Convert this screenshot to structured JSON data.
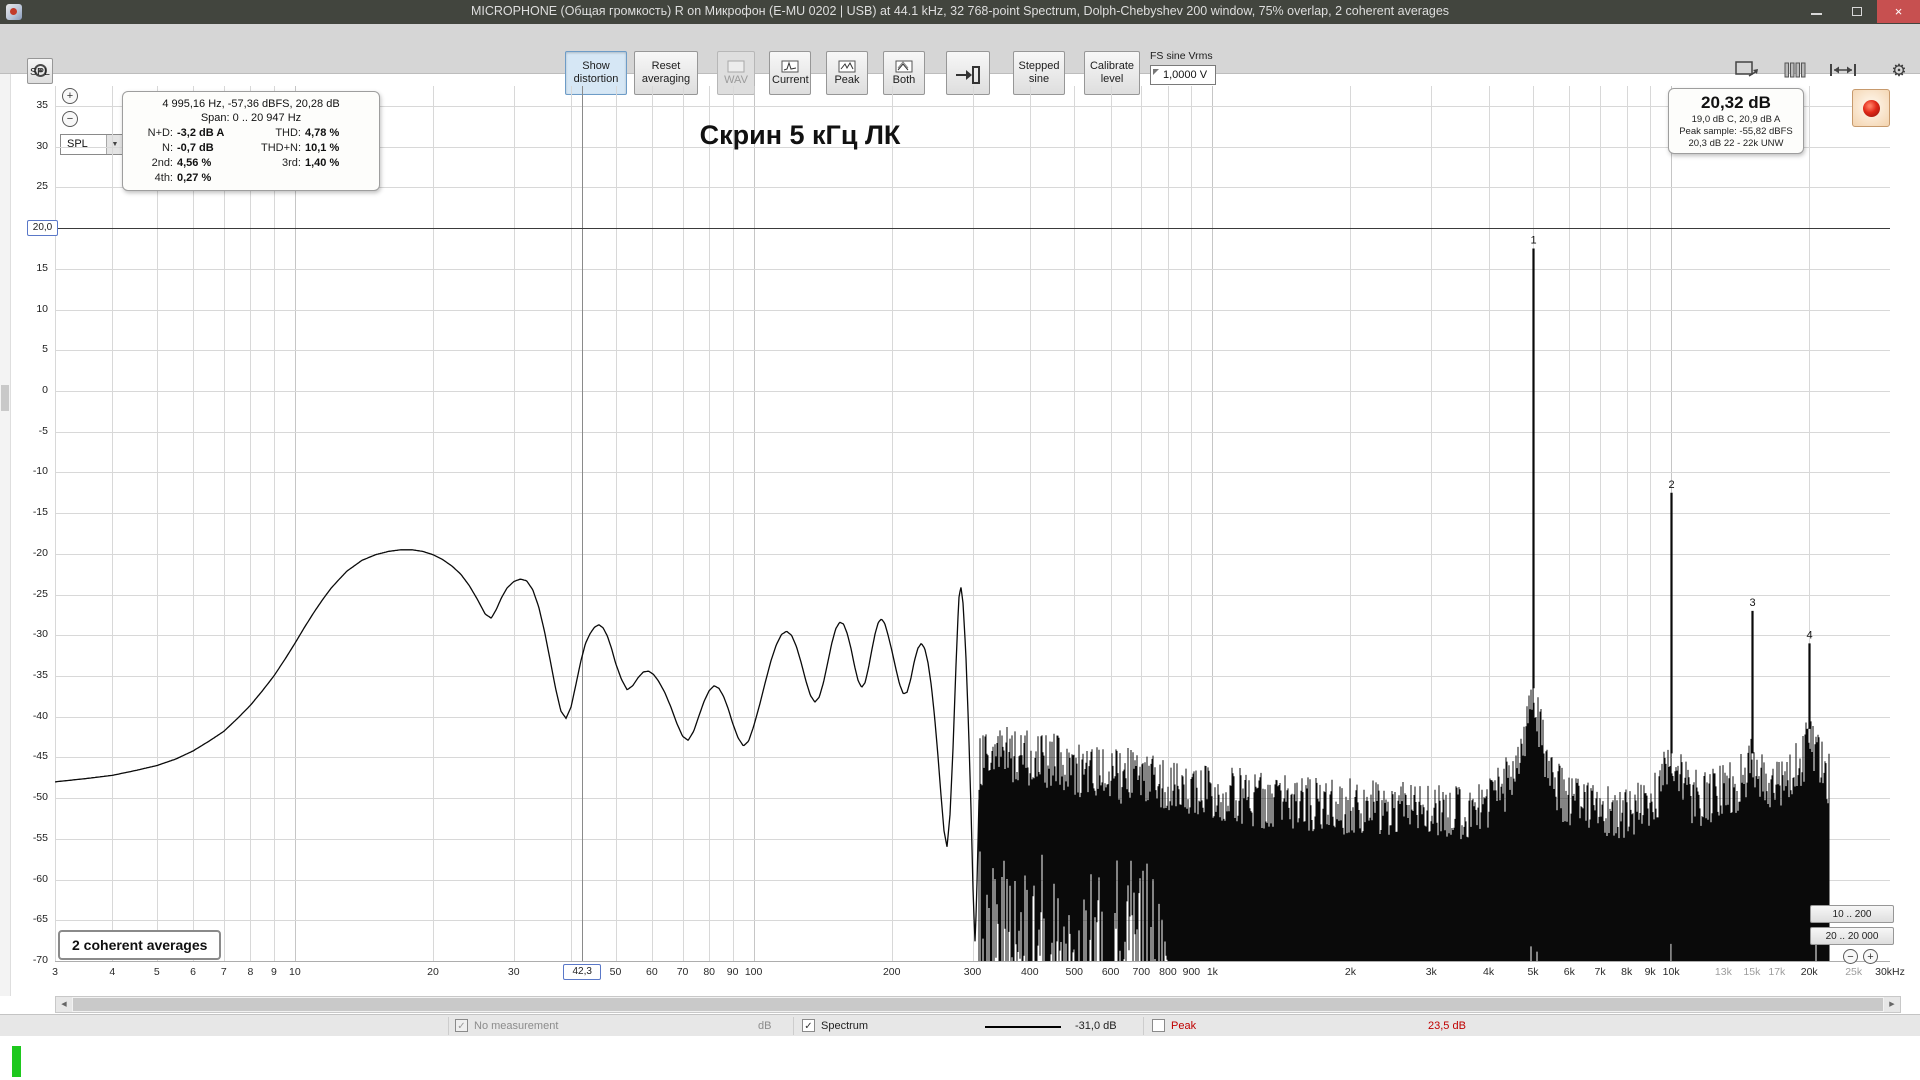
{
  "window": {
    "title": "MICROPHONE (Общая громкость) R on Микрофон (E-MU 0202 | USB) at 44.1 kHz, 32 768-point Spectrum, Dolph-Chebyshev 200 window, 75% overlap, 2 coherent averages"
  },
  "toolbar": {
    "show_distortion": "Show distortion",
    "reset_averaging": "Reset averaging",
    "wav": "WAV",
    "current": "Current",
    "peak": "Peak",
    "both": "Both",
    "stepped_sine": "Stepped sine",
    "calibrate_level": "Calibrate level",
    "fs_label": "FS sine Vrms",
    "fs_value": "1,0000 V"
  },
  "thd_panel": {
    "header": "4 995,16 Hz, -57,36 dBFS, 20,28 dB",
    "span": "Span: 0 .. 20 947 Hz",
    "nd_label": "N+D:",
    "nd": "-3,2 dB A",
    "thd_label": "THD:",
    "thd": "4,78 %",
    "n_label": "N:",
    "n": "-0,7 dB",
    "thdn_label": "THD+N:",
    "thdn": "10,1 %",
    "h2_label": "2nd:",
    "h2": "4,56 %",
    "h3_label": "3rd:",
    "h3": "1,40 %",
    "h4_label": "4th:",
    "h4": "0,27 %"
  },
  "level_panel": {
    "main": "20,32 dB",
    "line2": "19,0 dB C, 20,9 dB A",
    "line3": "Peak sample: -55,82 dBFS",
    "line4": "20,3 dB 22 - 22k UNW"
  },
  "plot": {
    "spl_unit": "SPL",
    "spl_combo": "SPL",
    "averages": "2 coherent averages",
    "range_top": "10 .. 200",
    "range_bottom": "20 .. 20 000"
  },
  "status": {
    "no_measurement": "No measurement",
    "db_unit": "dB",
    "spectrum": "Spectrum",
    "spectrum_value": "-31,0 dB",
    "peak": "Peak",
    "peak_value": "23,5 dB"
  },
  "icons": {
    "gear": "⚙",
    "combo_arrow": "▼",
    "scroll_left": "◀",
    "scroll_right": "▶",
    "plus": "+",
    "minus": "−",
    "check": "✓",
    "close": "×"
  },
  "chart_data": {
    "type": "line",
    "title": "Скрин 5 кГц ЛК",
    "xlabel": "Hz",
    "ylabel": "dB SPL",
    "x_axis": {
      "scale": "log",
      "min": 3,
      "max": 30000,
      "unit": "Hz"
    },
    "y_axis": {
      "min": -70,
      "max": 35,
      "unit": "dB",
      "grid_step": 5
    },
    "marker_db": 20.0,
    "marker_label": "20,0",
    "cursor_hz": 42.3,
    "cursor_label": "42,3",
    "signal_max_hz": 22050,
    "y_ticks": [
      35,
      30,
      25,
      20,
      15,
      10,
      5,
      0,
      -5,
      -10,
      -15,
      -20,
      -25,
      -30,
      -35,
      -40,
      -45,
      -50,
      -55,
      -60,
      -65,
      -70
    ],
    "x_ticks": [
      {
        "hz": 3,
        "label": "3"
      },
      {
        "hz": 4,
        "label": "4"
      },
      {
        "hz": 5,
        "label": "5"
      },
      {
        "hz": 6,
        "label": "6"
      },
      {
        "hz": 7,
        "label": "7"
      },
      {
        "hz": 8,
        "label": "8"
      },
      {
        "hz": 9,
        "label": "9"
      },
      {
        "hz": 10,
        "label": "10"
      },
      {
        "hz": 20,
        "label": "20"
      },
      {
        "hz": 30,
        "label": "30"
      },
      {
        "hz": 50,
        "label": "50"
      },
      {
        "hz": 60,
        "label": "60"
      },
      {
        "hz": 70,
        "label": "70"
      },
      {
        "hz": 80,
        "label": "80"
      },
      {
        "hz": 90,
        "label": "90"
      },
      {
        "hz": 100,
        "label": "100"
      },
      {
        "hz": 200,
        "label": "200"
      },
      {
        "hz": 300,
        "label": "300"
      },
      {
        "hz": 400,
        "label": "400"
      },
      {
        "hz": 500,
        "label": "500"
      },
      {
        "hz": 600,
        "label": "600"
      },
      {
        "hz": 700,
        "label": "700"
      },
      {
        "hz": 800,
        "label": "800"
      },
      {
        "hz": 900,
        "label": "900"
      },
      {
        "hz": 1000,
        "label": "1k"
      },
      {
        "hz": 2000,
        "label": "2k"
      },
      {
        "hz": 3000,
        "label": "3k"
      },
      {
        "hz": 4000,
        "label": "4k"
      },
      {
        "hz": 5000,
        "label": "5k"
      },
      {
        "hz": 6000,
        "label": "6k"
      },
      {
        "hz": 7000,
        "label": "7k"
      },
      {
        "hz": 8000,
        "label": "8k"
      },
      {
        "hz": 9000,
        "label": "9k"
      },
      {
        "hz": 10000,
        "label": "10k"
      },
      {
        "hz": 13000,
        "label": "13k",
        "muted": true
      },
      {
        "hz": 15000,
        "label": "15k",
        "muted": true
      },
      {
        "hz": 17000,
        "label": "17k",
        "muted": true
      },
      {
        "hz": 20000,
        "label": "20k"
      },
      {
        "hz": 25000,
        "label": "25k",
        "muted": true
      },
      {
        "hz": 30000,
        "label": "30kHz"
      }
    ],
    "peaks": [
      {
        "hz": 5000,
        "db": 17.5,
        "label": "1"
      },
      {
        "hz": 10000,
        "db": -12.5,
        "label": "2"
      },
      {
        "hz": 15000,
        "db": -27,
        "label": "3"
      },
      {
        "hz": 20000,
        "db": -31,
        "label": "4"
      }
    ],
    "envelope_db": [
      [
        3,
        -48
      ],
      [
        3.5,
        -47.6
      ],
      [
        4,
        -47.2
      ],
      [
        4.5,
        -46.6
      ],
      [
        5,
        -46
      ],
      [
        5.5,
        -45.2
      ],
      [
        6,
        -44.2
      ],
      [
        6.5,
        -43
      ],
      [
        7,
        -41.8
      ],
      [
        7.5,
        -40.2
      ],
      [
        8,
        -38.6
      ],
      [
        8.5,
        -36.8
      ],
      [
        9,
        -35
      ],
      [
        9.5,
        -33
      ],
      [
        10,
        -31
      ],
      [
        10.5,
        -29
      ],
      [
        11,
        -27.2
      ],
      [
        11.5,
        -25.6
      ],
      [
        12,
        -24.2
      ],
      [
        12.5,
        -23.1
      ],
      [
        13,
        -22.1
      ],
      [
        14,
        -20.8
      ],
      [
        15,
        -20.1
      ],
      [
        16,
        -19.7
      ],
      [
        17,
        -19.5
      ],
      [
        18,
        -19.5
      ],
      [
        19,
        -19.7
      ],
      [
        20,
        -20.1
      ],
      [
        21,
        -20.7
      ],
      [
        22,
        -21.5
      ],
      [
        23,
        -22.5
      ],
      [
        24,
        -23.9
      ],
      [
        25,
        -25.6
      ],
      [
        26,
        -27.4
      ],
      [
        26.8,
        -27.9
      ],
      [
        27.5,
        -26.8
      ],
      [
        28.2,
        -25.4
      ],
      [
        29,
        -24.2
      ],
      [
        30,
        -23.4
      ],
      [
        31,
        -23.1
      ],
      [
        32,
        -23.3
      ],
      [
        33,
        -24.4
      ],
      [
        34,
        -26.5
      ],
      [
        35,
        -29.5
      ],
      [
        36,
        -33
      ],
      [
        37,
        -36.5
      ],
      [
        38,
        -39.3
      ],
      [
        39,
        -40.2
      ],
      [
        40,
        -38.8
      ],
      [
        41,
        -36
      ],
      [
        42,
        -33.2
      ],
      [
        43,
        -31
      ],
      [
        44,
        -29.8
      ],
      [
        45,
        -29
      ],
      [
        46,
        -28.7
      ],
      [
        47,
        -29.1
      ],
      [
        48,
        -30.1
      ],
      [
        49,
        -31.6
      ],
      [
        50,
        -33.4
      ],
      [
        51.5,
        -35.4
      ],
      [
        53,
        -36.7
      ],
      [
        54.5,
        -36.2
      ],
      [
        56,
        -35.2
      ],
      [
        57.5,
        -34.5
      ],
      [
        59,
        -34.4
      ],
      [
        60.5,
        -34.8
      ],
      [
        62,
        -35.6
      ],
      [
        64,
        -37
      ],
      [
        66,
        -38.8
      ],
      [
        68,
        -40.8
      ],
      [
        70,
        -42.4
      ],
      [
        72,
        -42.9
      ],
      [
        74,
        -41.8
      ],
      [
        76,
        -39.9
      ],
      [
        78,
        -38.1
      ],
      [
        80,
        -36.8
      ],
      [
        82,
        -36.2
      ],
      [
        84,
        -36.5
      ],
      [
        86,
        -37.5
      ],
      [
        88,
        -39
      ],
      [
        90,
        -40.8
      ],
      [
        92.5,
        -42.6
      ],
      [
        95,
        -43.6
      ],
      [
        97.5,
        -43
      ],
      [
        100,
        -41.2
      ],
      [
        103,
        -38.6
      ],
      [
        106,
        -35.8
      ],
      [
        109,
        -33.2
      ],
      [
        112,
        -31.2
      ],
      [
        115,
        -29.9
      ],
      [
        118,
        -29.5
      ],
      [
        121,
        -30
      ],
      [
        124,
        -31.4
      ],
      [
        127,
        -33.4
      ],
      [
        130,
        -35.6
      ],
      [
        133,
        -37.4
      ],
      [
        136,
        -38.2
      ],
      [
        139,
        -37.6
      ],
      [
        142,
        -35.8
      ],
      [
        145,
        -33.4
      ],
      [
        148,
        -31
      ],
      [
        151,
        -29.2
      ],
      [
        154,
        -28.4
      ],
      [
        157,
        -28.6
      ],
      [
        160,
        -29.8
      ],
      [
        163,
        -31.6
      ],
      [
        166,
        -33.8
      ],
      [
        169,
        -35.6
      ],
      [
        172,
        -36.4
      ],
      [
        175,
        -35.8
      ],
      [
        178,
        -34
      ],
      [
        181,
        -31.8
      ],
      [
        184,
        -29.8
      ],
      [
        187,
        -28.4
      ],
      [
        190,
        -28
      ],
      [
        193,
        -28.5
      ],
      [
        196,
        -29.8
      ],
      [
        200,
        -31.8
      ],
      [
        204,
        -34
      ],
      [
        208,
        -36
      ],
      [
        212,
        -37.2
      ],
      [
        216,
        -37
      ],
      [
        220,
        -35.4
      ],
      [
        224,
        -33.2
      ],
      [
        228,
        -31.6
      ],
      [
        232,
        -31
      ],
      [
        236,
        -31.6
      ],
      [
        240,
        -33.4
      ],
      [
        244,
        -36.2
      ],
      [
        248,
        -40
      ],
      [
        252,
        -44.5
      ],
      [
        256,
        -49.5
      ],
      [
        260,
        -54
      ],
      [
        264,
        -56
      ],
      [
        268,
        -52
      ],
      [
        272,
        -44
      ],
      [
        276,
        -34
      ],
      [
        280,
        -25.5
      ],
      [
        283,
        -24
      ],
      [
        286,
        -26
      ],
      [
        290,
        -32
      ],
      [
        294,
        -41
      ],
      [
        298,
        -52
      ],
      [
        301,
        -62
      ],
      [
        304,
        -68
      ],
      [
        307,
        -60
      ],
      [
        310,
        -50
      ]
    ],
    "noise_top_db": [
      [
        310,
        -46
      ],
      [
        350,
        -44.5
      ],
      [
        400,
        -45
      ],
      [
        450,
        -45.5
      ],
      [
        500,
        -46.5
      ],
      [
        560,
        -47
      ],
      [
        630,
        -47.5
      ],
      [
        700,
        -47
      ],
      [
        800,
        -48
      ],
      [
        900,
        -48.5
      ],
      [
        1000,
        -49
      ],
      [
        1200,
        -50
      ],
      [
        1400,
        -50.5
      ],
      [
        1700,
        -51
      ],
      [
        2000,
        -51
      ],
      [
        2400,
        -51.5
      ],
      [
        2800,
        -51.5
      ],
      [
        3200,
        -52
      ],
      [
        3600,
        -52
      ],
      [
        4000,
        -51
      ],
      [
        4300,
        -49
      ],
      [
        4600,
        -46
      ],
      [
        4800,
        -42
      ],
      [
        4950,
        -38.5
      ],
      [
        5000,
        -37.5
      ],
      [
        5050,
        -38.5
      ],
      [
        5200,
        -42
      ],
      [
        5400,
        -46
      ],
      [
        5700,
        -49
      ],
      [
        6000,
        -50.5
      ],
      [
        6500,
        -51.5
      ],
      [
        7000,
        -52
      ],
      [
        7500,
        -52
      ],
      [
        8000,
        -52
      ],
      [
        8500,
        -51.5
      ],
      [
        9000,
        -50.5
      ],
      [
        9400,
        -49
      ],
      [
        9700,
        -47.5
      ],
      [
        9900,
        -46
      ],
      [
        10000,
        -45.5
      ],
      [
        10100,
        -46
      ],
      [
        10400,
        -47.5
      ],
      [
        10800,
        -49
      ],
      [
        11300,
        -50
      ],
      [
        12000,
        -50
      ],
      [
        12700,
        -49.5
      ],
      [
        13400,
        -49
      ],
      [
        14100,
        -48
      ],
      [
        14700,
        -46.5
      ],
      [
        15000,
        -45.5
      ],
      [
        15300,
        -46.5
      ],
      [
        15800,
        -48
      ],
      [
        16500,
        -48.5
      ],
      [
        17200,
        -48.5
      ],
      [
        18000,
        -47.5
      ],
      [
        18800,
        -46.5
      ],
      [
        19400,
        -45
      ],
      [
        19800,
        -43.5
      ],
      [
        20000,
        -42.5
      ],
      [
        20300,
        -43.5
      ],
      [
        20800,
        -45
      ],
      [
        21300,
        -46.5
      ],
      [
        21800,
        -47.5
      ],
      [
        22050,
        -48
      ]
    ]
  }
}
